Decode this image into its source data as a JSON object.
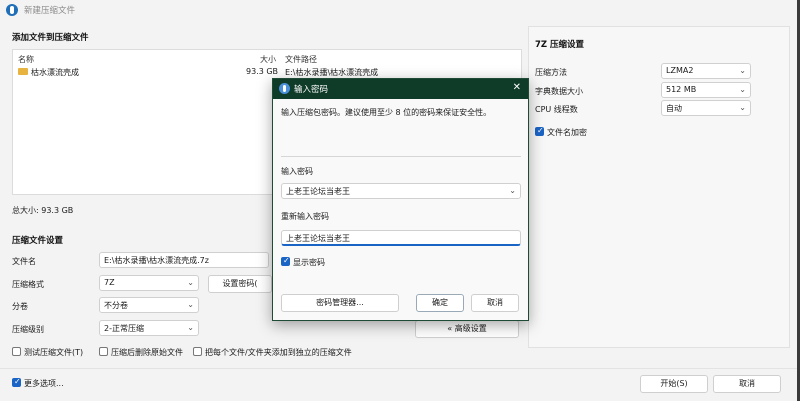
{
  "window": {
    "title": "新建压缩文件"
  },
  "add_section": {
    "title": "添加文件到压缩文件",
    "columns": {
      "name": "名称",
      "size": "大小",
      "path": "文件路径"
    },
    "files": [
      {
        "name": "枯水漂流壳成",
        "size": "93.3 GB",
        "path": "E:\\枯水录播\\枯水漂流壳成"
      }
    ],
    "total": "总大小: 93.3 GB"
  },
  "compress_settings": {
    "title": "压缩文件设置",
    "filename_label": "文件名",
    "filename_value": "E:\\枯水录播\\枯水漂流壳成.7z",
    "format_label": "压缩格式",
    "format_value": "7Z",
    "split_label": "分卷",
    "split_value": "不分卷",
    "level_label": "压缩级别",
    "level_value": "2-正常压缩",
    "set_password_button": "设置密码(",
    "advanced_button": "« 高级设置",
    "opt_test": "测试压缩文件(T)",
    "opt_delete": "压缩后删除原始文件",
    "opt_separate": "把每个文件/文件夹添加到独立的压缩文件"
  },
  "sevenz_settings": {
    "title": "7Z 压缩设置",
    "method_label": "压缩方法",
    "method_value": "LZMA2",
    "dict_label": "字典数据大小",
    "dict_value": "512 MB",
    "cpu_label": "CPU 线程数",
    "cpu_value": "自动",
    "encrypt_names": "文件名加密"
  },
  "footer": {
    "more_options": "更多选项...",
    "start_button": "开始(S)",
    "cancel_button": "取消"
  },
  "password_dialog": {
    "title": "输入密码",
    "hint": "输入压缩包密码。建议使用至少 8 位的密码来保证安全性。",
    "enter_label": "输入密码",
    "enter_value": "上老王论坛当老王",
    "reenter_label": "重新输入密码",
    "reenter_value": "上老王论坛当老王",
    "show_password": "显示密码",
    "manager_button": "密码管理器...",
    "ok_button": "确定",
    "cancel_button": "取消"
  },
  "colors": {
    "accent": "#1a64c5",
    "dialog_title_bg": "#0f3b29",
    "folder": "#e8b441"
  },
  "icons": [
    "app-icon",
    "folder-icon",
    "close-icon",
    "chevron-down-icon",
    "checkbox-icon"
  ]
}
